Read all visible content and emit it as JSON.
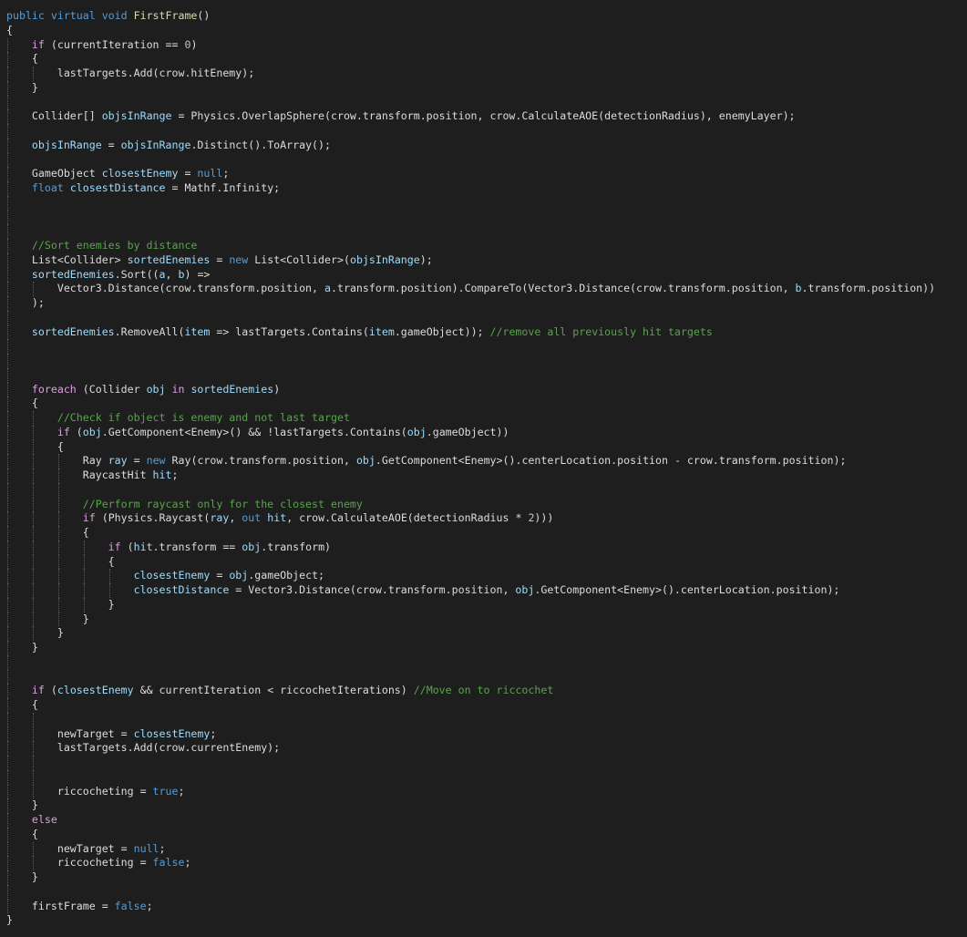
{
  "editor": {
    "theme": {
      "background": "#1e1e1e",
      "keyword": "#569cd6",
      "control": "#d8a0df",
      "default": "#dcdcdc",
      "identifier": "#9cdcfe",
      "comment": "#57a64a",
      "number": "#b5cea8",
      "method": "#dcdcaa"
    },
    "lines": [
      [
        [
          "kw",
          "public virtual void "
        ],
        [
          "mth",
          "FirstFrame"
        ],
        [
          "def",
          "()"
        ]
      ],
      [
        [
          "def",
          "{"
        ]
      ],
      [
        [
          "ctl",
          "    if"
        ],
        [
          "def",
          " (currentIteration == "
        ],
        [
          "num",
          "0"
        ],
        [
          "def",
          ")"
        ]
      ],
      [
        [
          "def",
          "    {"
        ]
      ],
      [
        [
          "def",
          "        lastTargets.Add(crow.hitEnemy);"
        ]
      ],
      [
        [
          "def",
          "    }"
        ]
      ],
      [],
      [
        [
          "def",
          "    Collider[] "
        ],
        [
          "id",
          "objsInRange"
        ],
        [
          "def",
          " = Physics.OverlapSphere(crow.transform.position, crow.CalculateAOE(detectionRadius), enemyLayer);"
        ]
      ],
      [],
      [
        [
          "id",
          "    objsInRange"
        ],
        [
          "def",
          " = "
        ],
        [
          "id",
          "objsInRange"
        ],
        [
          "def",
          ".Distinct().ToArray();"
        ]
      ],
      [],
      [
        [
          "def",
          "    GameObject "
        ],
        [
          "id",
          "closestEnemy"
        ],
        [
          "def",
          " = "
        ],
        [
          "kw",
          "null"
        ],
        [
          "def",
          ";"
        ]
      ],
      [
        [
          "kw",
          "    float "
        ],
        [
          "id",
          "closestDistance"
        ],
        [
          "def",
          " = Mathf.Infinity;"
        ]
      ],
      [],
      [],
      [],
      [
        [
          "cm",
          "    //Sort enemies by distance"
        ]
      ],
      [
        [
          "def",
          "    List<Collider> "
        ],
        [
          "id",
          "sortedEnemies"
        ],
        [
          "def",
          " = "
        ],
        [
          "kw",
          "new"
        ],
        [
          "def",
          " List<Collider>("
        ],
        [
          "id",
          "objsInRange"
        ],
        [
          "def",
          ");"
        ]
      ],
      [
        [
          "id",
          "    sortedEnemies"
        ],
        [
          "def",
          ".Sort(("
        ],
        [
          "id",
          "a"
        ],
        [
          "def",
          ", "
        ],
        [
          "id",
          "b"
        ],
        [
          "def",
          ") =>"
        ]
      ],
      [
        [
          "def",
          "        Vector3.Distance(crow.transform.position, "
        ],
        [
          "id",
          "a"
        ],
        [
          "def",
          ".transform.position).CompareTo(Vector3.Distance(crow.transform.position, "
        ],
        [
          "id",
          "b"
        ],
        [
          "def",
          ".transform.position))"
        ]
      ],
      [
        [
          "def",
          "    );"
        ]
      ],
      [],
      [
        [
          "id",
          "    sortedEnemies"
        ],
        [
          "def",
          ".RemoveAll("
        ],
        [
          "id",
          "item"
        ],
        [
          "def",
          " => lastTargets.Contains("
        ],
        [
          "id",
          "item"
        ],
        [
          "def",
          ".gameObject)); "
        ],
        [
          "cm",
          "//remove all previously hit targets"
        ]
      ],
      [],
      [],
      [],
      [
        [
          "ctl",
          "    foreach"
        ],
        [
          "def",
          " (Collider "
        ],
        [
          "id",
          "obj"
        ],
        [
          "ctl",
          " in "
        ],
        [
          "id",
          "sortedEnemies"
        ],
        [
          "def",
          ")"
        ]
      ],
      [
        [
          "def",
          "    {"
        ]
      ],
      [
        [
          "cm",
          "        //Check if object is enemy and not last target"
        ]
      ],
      [
        [
          "ctl",
          "        if"
        ],
        [
          "def",
          " ("
        ],
        [
          "id",
          "obj"
        ],
        [
          "def",
          ".GetComponent<Enemy>() && !lastTargets.Contains("
        ],
        [
          "id",
          "obj"
        ],
        [
          "def",
          ".gameObject))"
        ]
      ],
      [
        [
          "def",
          "        {"
        ]
      ],
      [
        [
          "def",
          "            Ray "
        ],
        [
          "id",
          "ray"
        ],
        [
          "def",
          " = "
        ],
        [
          "kw",
          "new"
        ],
        [
          "def",
          " Ray(crow.transform.position, "
        ],
        [
          "id",
          "obj"
        ],
        [
          "def",
          ".GetComponent<Enemy>().centerLocation.position - crow.transform.position);"
        ]
      ],
      [
        [
          "def",
          "            RaycastHit "
        ],
        [
          "id",
          "hit"
        ],
        [
          "def",
          ";"
        ]
      ],
      [],
      [
        [
          "cm",
          "            //Perform raycast only for the closest enemy"
        ]
      ],
      [
        [
          "ctl",
          "            if"
        ],
        [
          "def",
          " (Physics.Raycast("
        ],
        [
          "id",
          "ray"
        ],
        [
          "def",
          ", "
        ],
        [
          "kw",
          "out"
        ],
        [
          "def",
          " "
        ],
        [
          "id",
          "hit"
        ],
        [
          "def",
          ", crow.CalculateAOE(detectionRadius * "
        ],
        [
          "num",
          "2"
        ],
        [
          "def",
          ")))"
        ]
      ],
      [
        [
          "def",
          "            {"
        ]
      ],
      [
        [
          "ctl",
          "                if"
        ],
        [
          "def",
          " ("
        ],
        [
          "id",
          "hit"
        ],
        [
          "def",
          ".transform == "
        ],
        [
          "id",
          "obj"
        ],
        [
          "def",
          ".transform)"
        ]
      ],
      [
        [
          "def",
          "                {"
        ]
      ],
      [
        [
          "id",
          "                    closestEnemy"
        ],
        [
          "def",
          " = "
        ],
        [
          "id",
          "obj"
        ],
        [
          "def",
          ".gameObject;"
        ]
      ],
      [
        [
          "id",
          "                    closestDistance"
        ],
        [
          "def",
          " = Vector3.Distance(crow.transform.position, "
        ],
        [
          "id",
          "obj"
        ],
        [
          "def",
          ".GetComponent<Enemy>().centerLocation.position);"
        ]
      ],
      [
        [
          "def",
          "                }"
        ]
      ],
      [
        [
          "def",
          "            }"
        ]
      ],
      [
        [
          "def",
          "        }"
        ]
      ],
      [
        [
          "def",
          "    }"
        ]
      ],
      [],
      [],
      [
        [
          "ctl",
          "    if"
        ],
        [
          "def",
          " ("
        ],
        [
          "id",
          "closestEnemy"
        ],
        [
          "def",
          " && currentIteration < riccochetIterations) "
        ],
        [
          "cm",
          "//Move on to riccochet"
        ]
      ],
      [
        [
          "def",
          "    {"
        ]
      ],
      [],
      [
        [
          "def",
          "        newTarget = "
        ],
        [
          "id",
          "closestEnemy"
        ],
        [
          "def",
          ";"
        ]
      ],
      [
        [
          "def",
          "        lastTargets.Add(crow.currentEnemy);"
        ]
      ],
      [],
      [],
      [
        [
          "def",
          "        riccocheting = "
        ],
        [
          "kw",
          "true"
        ],
        [
          "def",
          ";"
        ]
      ],
      [
        [
          "def",
          "    }"
        ]
      ],
      [
        [
          "ctl",
          "    else"
        ]
      ],
      [
        [
          "def",
          "    {"
        ]
      ],
      [
        [
          "def",
          "        newTarget = "
        ],
        [
          "kw",
          "null"
        ],
        [
          "def",
          ";"
        ]
      ],
      [
        [
          "def",
          "        riccocheting = "
        ],
        [
          "kw",
          "false"
        ],
        [
          "def",
          ";"
        ]
      ],
      [
        [
          "def",
          "    }"
        ]
      ],
      [],
      [
        [
          "def",
          "    firstFrame = "
        ],
        [
          "kw",
          "false"
        ],
        [
          "def",
          ";"
        ]
      ],
      [
        [
          "def",
          "}"
        ]
      ]
    ]
  }
}
